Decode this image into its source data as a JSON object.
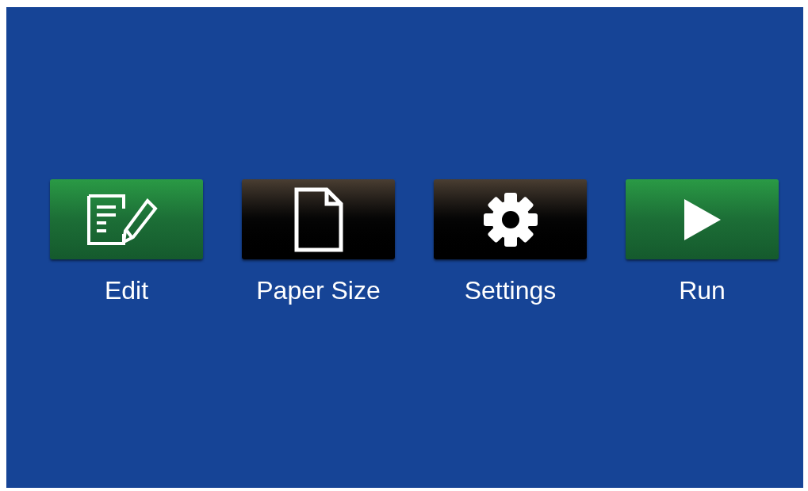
{
  "menu": [
    {
      "label": "Edit",
      "kind": "green"
    },
    {
      "label": "Paper Size",
      "kind": "black"
    },
    {
      "label": "Settings",
      "kind": "black"
    },
    {
      "label": "Run",
      "kind": "green"
    }
  ]
}
